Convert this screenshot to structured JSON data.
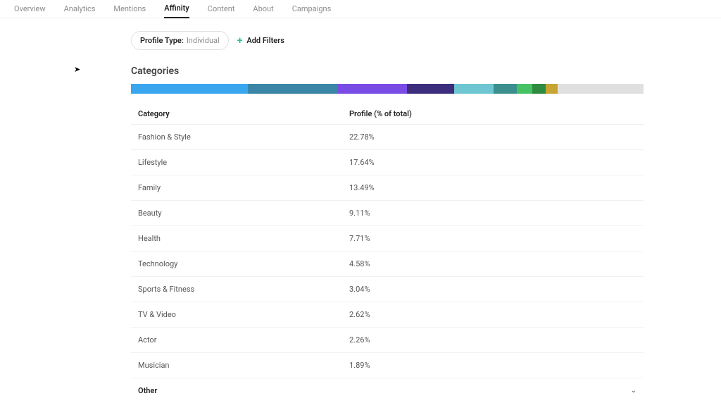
{
  "nav": {
    "tabs": [
      "Overview",
      "Analytics",
      "Mentions",
      "Affinity",
      "Content",
      "About",
      "Campaigns"
    ],
    "active_index": 3
  },
  "filters": {
    "profile_type_label": "Profile Type:",
    "profile_type_value": "Individual",
    "add_filters_label": "Add Filters"
  },
  "section_title": "Categories",
  "chart_data": {
    "type": "bar",
    "title": "Categories",
    "xlabel": "Category",
    "ylabel": "Profile (% of total)",
    "categories": [
      "Fashion & Style",
      "Lifestyle",
      "Family",
      "Beauty",
      "Health",
      "Technology",
      "Sports & Fitness",
      "TV & Video",
      "Actor",
      "Musician",
      "Other"
    ],
    "values": [
      22.78,
      17.64,
      13.49,
      9.11,
      7.71,
      4.58,
      3.04,
      2.62,
      2.26,
      1.89,
      14.88
    ],
    "colors": [
      "#39a6ee",
      "#3b85a7",
      "#7a4ce6",
      "#3c2d7d",
      "#6ec6d2",
      "#3b8f8d",
      "#46c264",
      "#2f8b3f",
      "#c9a432",
      "#e0e0e0"
    ]
  },
  "table": {
    "headers": [
      "Category",
      "Profile (% of total)"
    ],
    "rows": [
      {
        "category": "Fashion & Style",
        "percent": "22.78%"
      },
      {
        "category": "Lifestyle",
        "percent": "17.64%"
      },
      {
        "category": "Family",
        "percent": "13.49%"
      },
      {
        "category": "Beauty",
        "percent": "9.11%"
      },
      {
        "category": "Health",
        "percent": "7.71%"
      },
      {
        "category": "Technology",
        "percent": "4.58%"
      },
      {
        "category": "Sports & Fitness",
        "percent": "3.04%"
      },
      {
        "category": "TV & Video",
        "percent": "2.62%"
      },
      {
        "category": "Actor",
        "percent": "2.26%"
      },
      {
        "category": "Musician",
        "percent": "1.89%"
      }
    ],
    "other_label": "Other"
  }
}
